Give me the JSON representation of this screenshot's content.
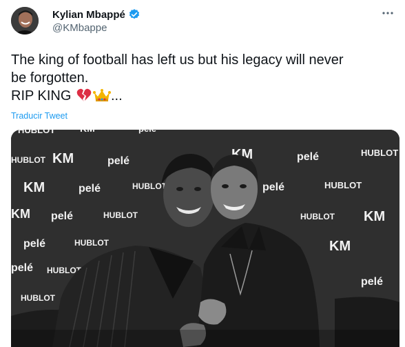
{
  "author": {
    "display_name": "Kylian Mbappé",
    "handle": "@KMbappe",
    "avatar_icon": "avatar-photo",
    "verified_icon": "verified-badge-icon"
  },
  "tweet": {
    "text_line1": "The king of football has left us but his legacy will never",
    "text_line2": "be forgotten.",
    "text_line3": "RIP KING",
    "emojis": [
      "broken-heart-icon",
      "crown-icon"
    ],
    "ellipsis": "...",
    "translate_label": "Traducir Tweet"
  },
  "media": {
    "backdrop_logos": {
      "brand_a": "HUBLOT",
      "brand_b": "pelé",
      "brand_c": "KM"
    },
    "description_icon": "photo-two-men-embracing"
  },
  "colors": {
    "accent": "#1d9bf0",
    "text": "#0f1419",
    "secondary_text": "#536471"
  }
}
